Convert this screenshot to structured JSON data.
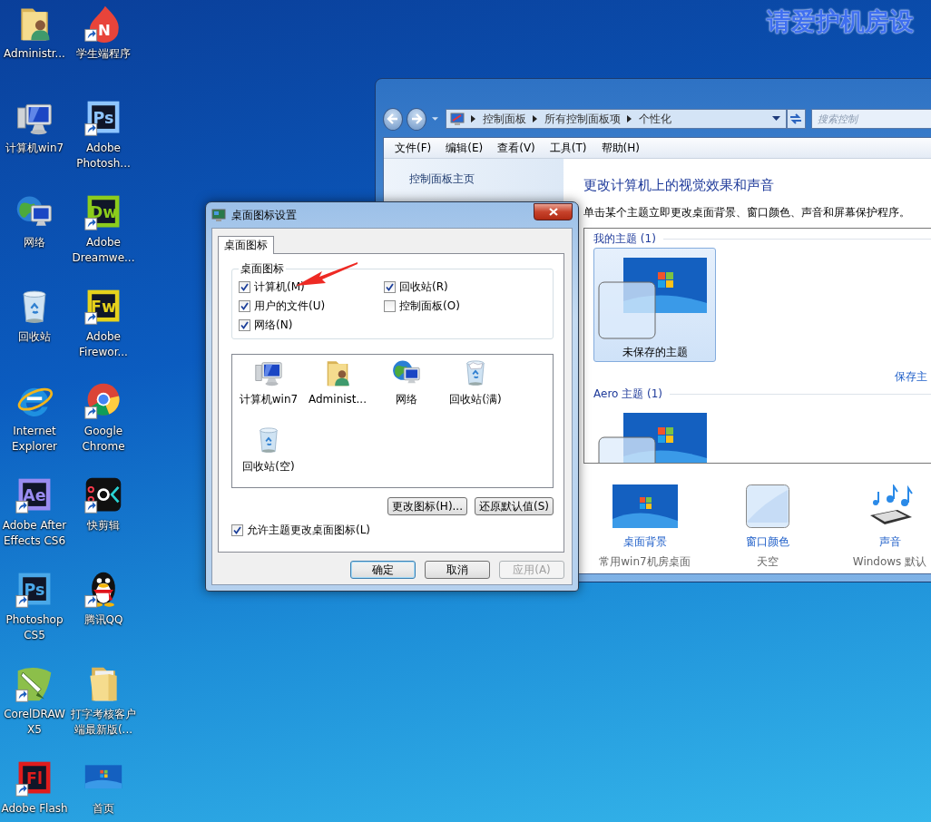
{
  "wallpaper_text": "请爱护机房设",
  "desktop_icons": [
    {
      "label": "Administr...",
      "kind": "user-folder",
      "shortcut": false
    },
    {
      "label": "计算机win7",
      "kind": "computer",
      "shortcut": false
    },
    {
      "label": "网络",
      "kind": "network",
      "shortcut": false
    },
    {
      "label": "回收站",
      "kind": "recycle",
      "shortcut": false
    },
    {
      "label": "Internet Explorer",
      "kind": "ie",
      "shortcut": false
    },
    {
      "label": "Adobe After Effects CS6",
      "kind": "adobe",
      "logo_text": "Ae",
      "color": "#9a8cf0",
      "shortcut": true
    },
    {
      "label": "Photoshop CS5",
      "kind": "adobe",
      "logo_text": "Ps",
      "color": "#4aa8e8",
      "shortcut": true
    },
    {
      "label": "CorelDRAW X5",
      "kind": "corel",
      "shortcut": true
    },
    {
      "label": "Adobe Flash",
      "kind": "adobe",
      "logo_text": "Fl",
      "color": "#e01c1c",
      "shortcut": true
    },
    {
      "label": "学生端程序",
      "kind": "app",
      "logo_text": "N",
      "shortcut": true
    },
    {
      "label": "Adobe Photosh...",
      "kind": "adobe",
      "logo_text": "Ps",
      "color": "#8ec5ff",
      "shortcut": true
    },
    {
      "label": "Adobe Dreamwe...",
      "kind": "adobe",
      "logo_text": "Dw",
      "color": "#8ccc1c",
      "shortcut": true
    },
    {
      "label": "Adobe Firewor...",
      "kind": "adobe",
      "logo_text": "Fw",
      "color": "#e6d21c",
      "shortcut": true
    },
    {
      "label": "Google Chrome",
      "kind": "chrome",
      "shortcut": true
    },
    {
      "label": "快剪辑",
      "kind": "video-editor",
      "shortcut": true
    },
    {
      "label": "腾讯QQ",
      "kind": "penguin",
      "shortcut": true
    },
    {
      "label": "打字考核客户端最新版(...",
      "kind": "folder",
      "shortcut": false
    },
    {
      "label": "首页",
      "kind": "thumbnail",
      "shortcut": false
    }
  ],
  "explorer": {
    "breadcrumb": [
      "控制面板",
      "所有控制面板项",
      "个性化"
    ],
    "search": {
      "placeholder": "搜索控制"
    },
    "menu": [
      "文件(F)",
      "编辑(E)",
      "查看(V)",
      "工具(T)",
      "帮助(H)"
    ],
    "sidebar_links": [
      "控制面板主页"
    ],
    "heading": "更改计算机上的视觉效果和声音",
    "description": "单击某个主题立即更改桌面背景、窗口颜色、声音和屏幕保护程序。",
    "theme_groups": [
      {
        "title": "我的主题 (1)",
        "themes": [
          {
            "label": "未保存的主题",
            "selected": true
          }
        ],
        "save_link": "保存主"
      },
      {
        "title": "Aero 主题 (1)",
        "themes": [
          {
            "selected": false
          }
        ]
      }
    ],
    "settings": [
      {
        "kind": "background",
        "title": "桌面背景",
        "subtitle": "常用win7机房桌面"
      },
      {
        "kind": "color",
        "title": "窗口颜色",
        "subtitle": "天空"
      },
      {
        "kind": "sound",
        "title": "声音",
        "subtitle": "Windows 默认"
      }
    ]
  },
  "dialog": {
    "title": "桌面图标设置",
    "tabs": [
      {
        "label": "桌面图标",
        "selected": true
      }
    ],
    "group_title": "桌面图标",
    "checkboxes": [
      {
        "label": "计算机(M)",
        "checked": true
      },
      {
        "label": "回收站(R)",
        "checked": true
      },
      {
        "label": "用户的文件(U)",
        "checked": true
      },
      {
        "label": "控制面板(O)",
        "checked": false
      },
      {
        "label": "网络(N)",
        "checked": true
      }
    ],
    "icons": [
      {
        "label": "计算机win7",
        "kind": "computer"
      },
      {
        "label": "Administ...",
        "kind": "user-folder"
      },
      {
        "label": "网络",
        "kind": "network"
      },
      {
        "label": "回收站(满)",
        "kind": "recycle-full"
      },
      {
        "label": "回收站(空)",
        "kind": "recycle"
      }
    ],
    "icon_buttons": [
      "更改图标(H)...",
      "还原默认值(S)"
    ],
    "allow_theme": {
      "label": "允许主题更改桌面图标(L)",
      "checked": true
    },
    "buttons": [
      {
        "label": "确定",
        "default": true,
        "disabled": false
      },
      {
        "label": "取消",
        "default": false,
        "disabled": false
      },
      {
        "label": "应用(A)",
        "default": false,
        "disabled": true
      }
    ]
  }
}
